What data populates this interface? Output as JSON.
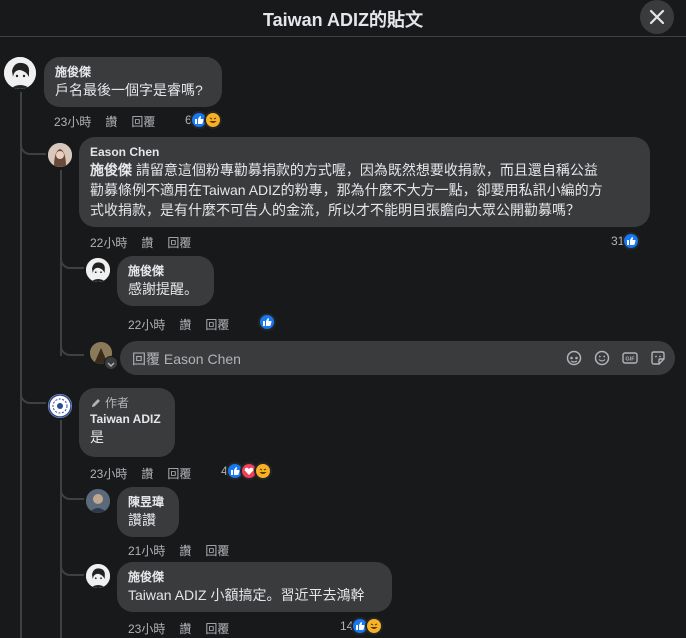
{
  "header": {
    "title": "Taiwan ADIZ的貼文"
  },
  "comments": [
    {
      "author": "施俊傑",
      "text": "戶名最後一個字是睿嗎?",
      "time": "23小時",
      "like": "讚",
      "reply": "回覆",
      "reactions": "6"
    },
    {
      "author": "Eason Chen",
      "mention": "施俊傑",
      "text": " 請留意這個粉專勸募捐款的方式喔，因為既然想要收捐款，而且還自稱公益",
      "text2": "勸募條例不適用在Taiwan ADIZ的粉專，那為什麼不大方一點，卻要用私訊小編的方",
      "text3": "式收捐款，是有什麼不可告人的金流，所以才不能明目張膽向大眾公開勸募嗎？",
      "time": "22小時",
      "like": "讚",
      "reply": "回覆",
      "reactions": "31"
    },
    {
      "author": "施俊傑",
      "text": "感謝提醒。",
      "time": "22小時",
      "like": "讚",
      "reply": "回覆"
    },
    {
      "role": "作者",
      "author": "Taiwan ADIZ",
      "text": "是",
      "time": "23小時",
      "like": "讚",
      "reply": "回覆",
      "reactions": "4"
    },
    {
      "author": "陳昱瑋",
      "text": "讚讚",
      "time": "21小時",
      "like": "讚",
      "reply": "回覆"
    },
    {
      "author": "施俊傑",
      "text": "Taiwan ADIZ 小額搞定。習近平去鴻幹",
      "time": "23小時",
      "like": "讚",
      "reply": "回覆",
      "reactions": "14"
    }
  ],
  "reply_box": {
    "placeholder": "回覆 Eason Chen",
    "gif": "GIF"
  },
  "colors": {
    "like": "#1877f2",
    "love": "#f33e58",
    "haha": "#f7b125"
  }
}
